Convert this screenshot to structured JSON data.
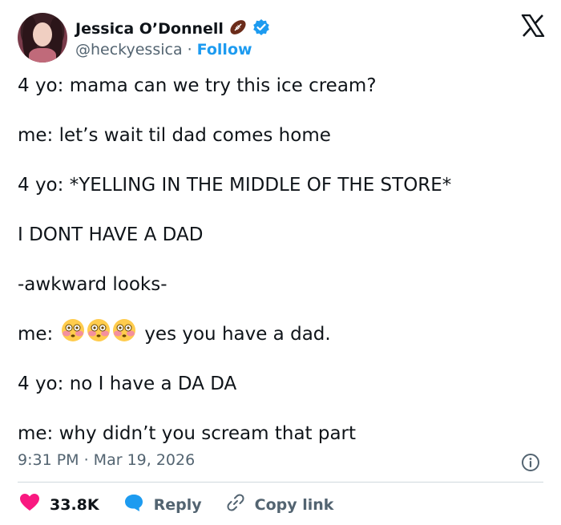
{
  "author": {
    "name": "Jessica O’Donnell",
    "handle": "@heckyessica",
    "separator": "·",
    "follow_label": "Follow"
  },
  "tweet": {
    "lines": [
      "4 yo: mama can we try this ice cream?",
      "me: let’s wait til dad comes home",
      "4 yo: *YELLING IN THE MIDDLE OF THE STORE*",
      "I DONT HAVE A DAD",
      "-awkward looks-",
      "me:",
      "yes you have a dad.",
      "4 yo: no I have a DA DA",
      "me: why didn’t you scream that part"
    ],
    "time": "9:31 PM · Mar 19, 2026"
  },
  "actions": {
    "likes": "33.8K",
    "reply_label": "Reply",
    "copy_label": "Copy link"
  },
  "colors": {
    "accent": "#1d9bf0",
    "like": "#f91880",
    "muted": "#536471",
    "text": "#0f1419"
  },
  "icons": [
    "football-icon",
    "verified-icon",
    "x-logo-icon",
    "flushed-face-icon",
    "info-icon",
    "heart-icon",
    "reply-bubble-icon",
    "link-icon"
  ]
}
